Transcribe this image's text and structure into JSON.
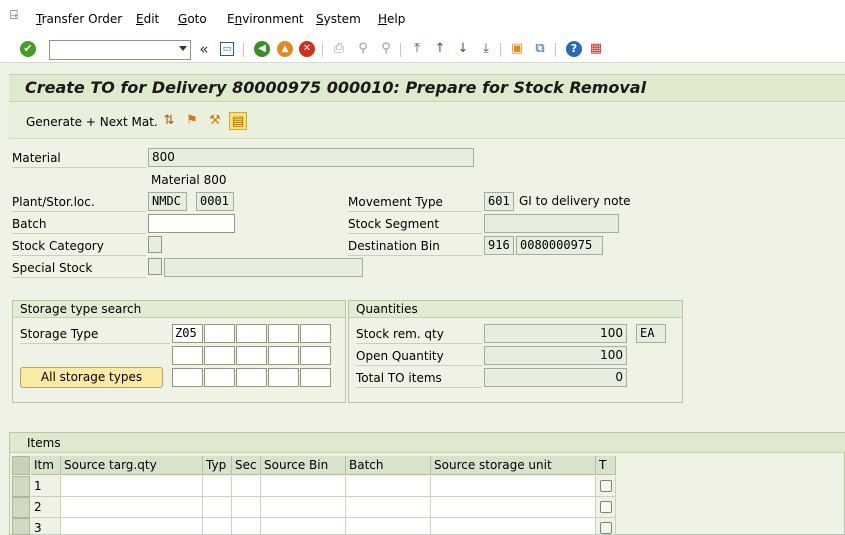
{
  "menu": {
    "items": [
      {
        "pre": "",
        "ul": "T",
        "post": "ransfer Order"
      },
      {
        "pre": "",
        "ul": "E",
        "post": "dit"
      },
      {
        "pre": "",
        "ul": "G",
        "post": "oto"
      },
      {
        "pre": "E",
        "ul": "n",
        "post": "vironment"
      },
      {
        "pre": "",
        "ul": "S",
        "post": "ystem"
      },
      {
        "pre": "",
        "ul": "H",
        "post": "elp"
      }
    ]
  },
  "toolbar": {
    "command_value": "",
    "icons": [
      "enter-icon",
      "back-icon",
      "save-icon",
      "back-icon",
      "exit-icon",
      "cancel-icon",
      "print-icon",
      "find-icon",
      "find-next-icon",
      "first-page-icon",
      "prev-page-icon",
      "next-page-icon",
      "last-page-icon",
      "create-session-icon",
      "shortcut-icon",
      "help-icon",
      "customize-layout-icon"
    ],
    "glyphs": {
      "enter": "✔",
      "double_back": "«",
      "save": "💾",
      "back": "◀",
      "exit": "▲",
      "cancel": "✕",
      "print": "⎙",
      "find": "⚲",
      "find_next": "⚲",
      "first": "⤒",
      "prev": "↑",
      "next": "↓",
      "last": "⤓",
      "session": "▣",
      "shortcut": "⧉",
      "help": "?",
      "layout": "▦"
    }
  },
  "title": "Create TO for Delivery 80000975 000010: Prepare for Stock Removal",
  "app_toolbar": {
    "generate_label": "Generate + Next Mat.",
    "icon_glyphs": [
      "⇅",
      "⚑",
      "⚒",
      "▤"
    ]
  },
  "form": {
    "material_label": "Material",
    "material_value": "800",
    "material_desc": "Material 800",
    "plant_label": "Plant/Stor.loc.",
    "plant_value": "NMDC",
    "sloc_value": "0001",
    "batch_label": "Batch",
    "batch_value": "",
    "stock_cat_label": "Stock Category",
    "special_stock_label": "Special Stock",
    "movement_type_label": "Movement Type",
    "movement_type_value": "601",
    "movement_type_desc": "GI to delivery note",
    "stock_segment_label": "Stock Segment",
    "stock_segment_value": "",
    "dest_bin_label": "Destination Bin",
    "dest_bin_type": "916",
    "dest_bin_value": "0080000975"
  },
  "storage_search": {
    "title": "Storage type search",
    "storage_type_label": "Storage Type",
    "storage_types": [
      "Z05",
      "",
      "",
      "",
      "",
      "",
      "",
      "",
      "",
      "",
      "",
      "",
      "",
      "",
      ""
    ],
    "all_button_label": "All storage types"
  },
  "quantities": {
    "title": "Quantities",
    "stock_rem_label": "Stock rem. qty",
    "stock_rem_value": "100",
    "unit": "EA",
    "open_qty_label": "Open Quantity",
    "open_qty_value": "100",
    "total_to_label": "Total TO items",
    "total_to_value": "0"
  },
  "items": {
    "title": "Items",
    "columns": [
      "Itm",
      "Source targ.qty",
      "Typ",
      "Sec",
      "Source Bin",
      "Batch",
      "Source storage unit",
      "T"
    ],
    "rows": [
      {
        "itm": "1"
      },
      {
        "itm": "2"
      },
      {
        "itm": "3"
      }
    ]
  }
}
